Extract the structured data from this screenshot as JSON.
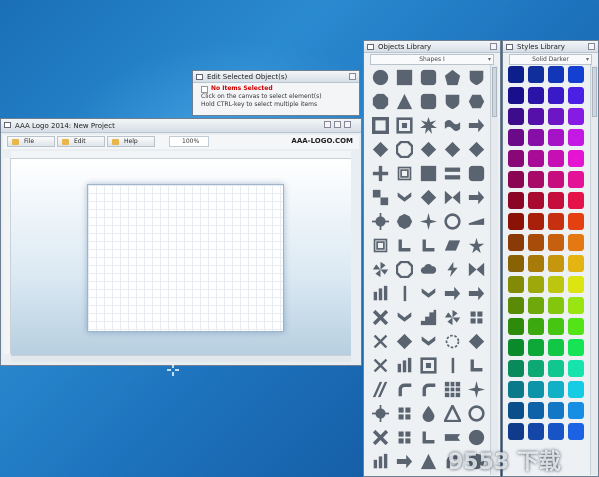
{
  "main_window": {
    "title": "AAA Logo 2014: New Project",
    "menu": [
      {
        "label": "File"
      },
      {
        "label": "Edit"
      },
      {
        "label": "Help"
      }
    ],
    "zoom": "100%",
    "brand": "AAA-LOGO.COM"
  },
  "edit_panel": {
    "title": "Edit Selected Object(s)",
    "status": "No Items Selected",
    "hint1": "Click on the canvas to select element(s)",
    "hint2": "Hold CTRL-key to select multiple items"
  },
  "objects_panel": {
    "title": "Objects Library",
    "category": "Shapes I",
    "shapes": [
      "circle-shape",
      "square-shape",
      "rounded-square-shape",
      "pentagon-shape",
      "shield-shape",
      "octagon-shape",
      "triangle-shape",
      "rounded-square-shape",
      "shield-shape",
      "hexagon-shape",
      "square-outline-shape",
      "frame-shape",
      "starburst-shape",
      "wave-shape",
      "arrow-shape",
      "diamond-shape",
      "octagon-frame-shape",
      "diamond-shape",
      "diamond-shape",
      "diamond-shape",
      "plus-shape",
      "square-frame-shape",
      "square-shape",
      "tabs-shape",
      "rounded-square-shape",
      "checker-shape",
      "chevrons-shape",
      "diamond-shape",
      "bowtie-shape",
      "arrow-shape",
      "gear-shape",
      "badge-shape",
      "star4-shape",
      "circle-frame-shape",
      "wedge-shape",
      "square-frame-shape",
      "corner-shape",
      "corner-shape",
      "parallelogram-shape",
      "star-shape",
      "pinwheel-shape",
      "octagon-frame-shape",
      "cloud-shape",
      "bolt-shape",
      "bowtie-shape",
      "bars-shape",
      "line-shape",
      "chevrons-shape",
      "arrow-shape",
      "arrow-shape",
      "cross-shape",
      "chevrons-shape",
      "stairs-shape",
      "pinwheel-shape",
      "knot-shape",
      "x-shape",
      "diamond-shape",
      "chevrons-shape",
      "ring-shape",
      "diamond-shape",
      "x-shape",
      "bars-shape",
      "frame-shape",
      "line-shape",
      "corner-shape",
      "stripes-shape",
      "arc-shape",
      "arc-shape",
      "grid-shape",
      "star4-shape",
      "gear-shape",
      "knot-shape",
      "drop-shape",
      "triangles-shape",
      "circle-frame-shape",
      "cross-shape",
      "knot-shape",
      "corner-shape",
      "ribbon-shape",
      "circle-shape",
      "bars-shape",
      "arrow-shape",
      "triangle-shape",
      "arc-shape",
      "circle-shape"
    ],
    "watermark": "9553 下载"
  },
  "styles_panel": {
    "title": "Styles Library",
    "category": "Solid Darker",
    "colors": [
      "#0d1f8a",
      "#102e9c",
      "#1236b8",
      "#1440d2",
      "#1a0f8a",
      "#2a14a8",
      "#3a1ac6",
      "#4a20e4",
      "#3c0c8a",
      "#5410a8",
      "#6c16c6",
      "#861ce4",
      "#6a0a88",
      "#880ea8",
      "#a612c6",
      "#c418e4",
      "#880878",
      "#a80c96",
      "#c610b4",
      "#e414d2",
      "#8a0652",
      "#a80a68",
      "#c60e7e",
      "#e41296",
      "#8a0624",
      "#a80a30",
      "#c60e3c",
      "#e41248",
      "#8a1206",
      "#a8200a",
      "#c6300e",
      "#e44012",
      "#8a3a06",
      "#a84c0a",
      "#c6600e",
      "#e47812",
      "#8a6206",
      "#a87a0a",
      "#c6960e",
      "#e4b412",
      "#828a06",
      "#9ea80a",
      "#bcc60e",
      "#dce412",
      "#5a8a06",
      "#6ea80a",
      "#84c60e",
      "#9ae412",
      "#2e8a0a",
      "#3aa80e",
      "#46c612",
      "#52e416",
      "#0a8a2a",
      "#0ea838",
      "#12c646",
      "#16e454",
      "#0a8a5a",
      "#0ea874",
      "#12c690",
      "#16e4ac",
      "#0a7a8a",
      "#0e94a8",
      "#12b0c6",
      "#16cce4",
      "#0a4e8a",
      "#0e62a8",
      "#1278c6",
      "#168ee4",
      "#103a8a",
      "#1446a8",
      "#1854c6",
      "#1c62e4"
    ]
  }
}
